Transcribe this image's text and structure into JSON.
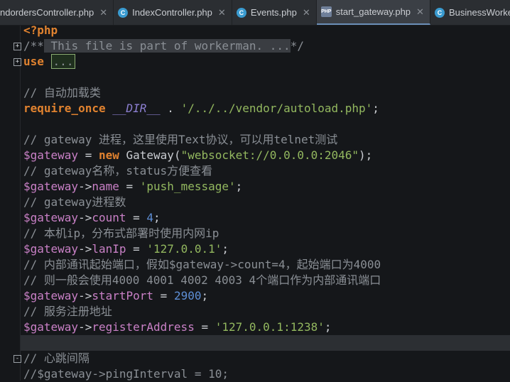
{
  "tabs": [
    {
      "label": "ndordersController.php",
      "icon": "php-class-icon",
      "active": false
    },
    {
      "label": "IndexController.php",
      "icon": "php-class-icon",
      "active": false
    },
    {
      "label": "Events.php",
      "icon": "php-class-icon",
      "active": false
    },
    {
      "label": "start_gateway.php",
      "icon": "php-file-icon",
      "active": true
    },
    {
      "label": "BusinessWorker.",
      "icon": "php-class-icon",
      "active": false
    }
  ],
  "code": {
    "l1": "<?php",
    "l2_a": "/**",
    "l2_b": " This file is part of workerman. ...",
    "l2_c": "*/",
    "l3_a": "use",
    "l3_b": "...",
    "l5": "// 自动加载类",
    "l6_a": "require_once",
    "l6_b": "__DIR__",
    "l6_c": " . ",
    "l6_d": "'/../../vendor/autoload.php'",
    "l6_e": ";",
    "l8": "// gateway 进程，这里使用Text协议，可以用telnet测试",
    "l9_a": "$gateway",
    "l9_b": " = ",
    "l9_c": "new",
    "l9_d": " Gateway(",
    "l9_e": "\"websocket://0.0.0.0:2046\"",
    "l9_f": ");",
    "l10": "// gateway名称，status方便查看",
    "l11_a": "$gateway",
    "l11_b": "->",
    "l11_c": "name",
    "l11_d": " = ",
    "l11_e": "'push_message'",
    "l11_f": ";",
    "l12": "// gateway进程数",
    "l13_a": "$gateway",
    "l13_b": "->",
    "l13_c": "count",
    "l13_d": " = ",
    "l13_e": "4",
    "l13_f": ";",
    "l14": "// 本机ip，分布式部署时使用内网ip",
    "l15_a": "$gateway",
    "l15_b": "->",
    "l15_c": "lanIp",
    "l15_d": " = ",
    "l15_e": "'127.0.0.1'",
    "l15_f": ";",
    "l16": "// 内部通讯起始端口，假如$gateway->count=4，起始端口为4000",
    "l17": "// 则一般会使用4000 4001 4002 4003 4个端口作为内部通讯端口",
    "l18_a": "$gateway",
    "l18_b": "->",
    "l18_c": "startPort",
    "l18_d": " = ",
    "l18_e": "2900",
    "l18_f": ";",
    "l19": "// 服务注册地址",
    "l20_a": "$gateway",
    "l20_b": "->",
    "l20_c": "registerAddress",
    "l20_d": " = ",
    "l20_e": "'127.0.0.1:1238'",
    "l20_f": ";",
    "l22": "// 心跳间隔",
    "l23": "//$gateway->pingInterval = 10;"
  },
  "colors": {
    "background": "#15171a",
    "keyword": "#e0822f",
    "string": "#93b85f",
    "variable": "#c980c6",
    "number": "#5e8fd6",
    "comment": "#8a8f95"
  }
}
